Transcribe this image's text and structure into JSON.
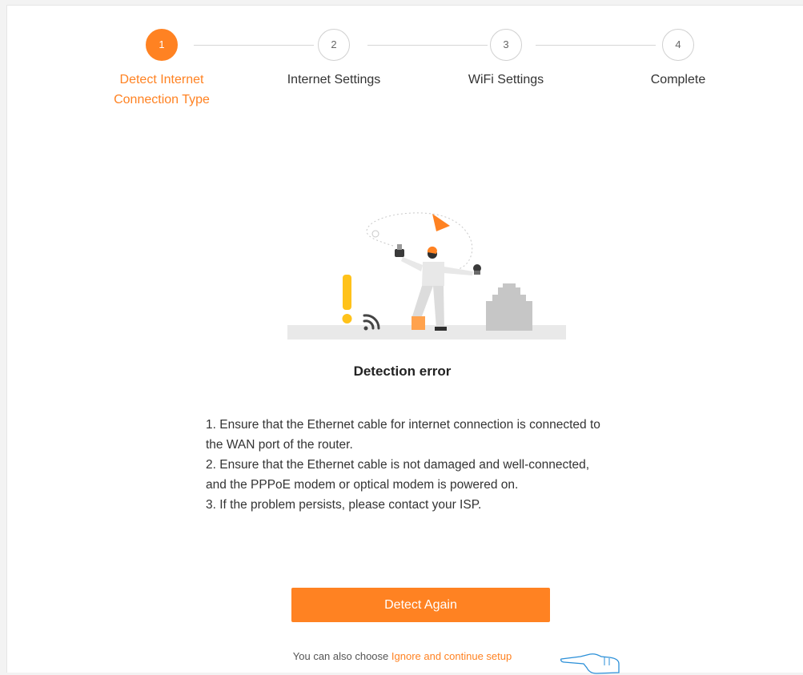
{
  "stepper": {
    "steps": [
      {
        "number": "1",
        "label_line1": "Detect Internet",
        "label_line2": "Connection Type",
        "active": true
      },
      {
        "number": "2",
        "label_line1": "Internet Settings",
        "label_line2": "",
        "active": false
      },
      {
        "number": "3",
        "label_line1": "WiFi Settings",
        "label_line2": "",
        "active": false
      },
      {
        "number": "4",
        "label_line1": "Complete",
        "label_line2": "",
        "active": false
      }
    ]
  },
  "status": {
    "title": "Detection error",
    "tips": [
      "1. Ensure that the Ethernet cable for internet connection is connected to the WAN port of the router.",
      "2. Ensure that the Ethernet cable is not damaged and well-connected, and the PPPoE modem or optical modem is powered on.",
      "3. If the problem persists, please contact your ISP."
    ]
  },
  "actions": {
    "detect_again_label": "Detect Again",
    "alternative_prefix": "You can also choose ",
    "ignore_link_label": "Ignore and continue setup"
  },
  "colors": {
    "accent": "#ff8222",
    "warning_yellow": "#ffc21a",
    "muted": "#c8c8c8"
  },
  "icons": [
    "warning-exclamation-icon",
    "wifi-signal-icon",
    "ethernet-port-icon",
    "pointing-hand-icon"
  ]
}
